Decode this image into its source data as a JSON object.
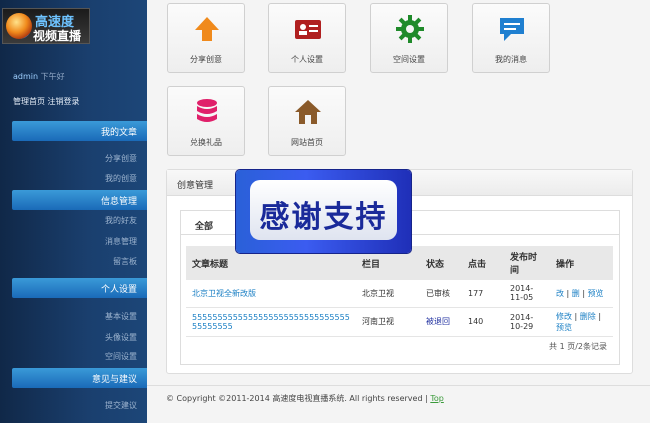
{
  "brand": {
    "line1": "高速度",
    "line2": "视频直播"
  },
  "user": {
    "name": "admin",
    "greeting": "下午好"
  },
  "top_links": "管理首页 注销登录",
  "sidebar": {
    "sections": [
      {
        "title": "我的文章",
        "items": [
          "分享创意",
          "我的创意"
        ]
      },
      {
        "title": "信息管理",
        "items": [
          "我的好友",
          "消息管理",
          "留言板"
        ]
      },
      {
        "title": "个人设置",
        "items": [
          "基本设置",
          "头像设置",
          "空间设置"
        ]
      },
      {
        "title": "意见与建议",
        "items": [
          "提交建议"
        ]
      }
    ]
  },
  "tiles": [
    {
      "label": "分享创意",
      "icon": "upload-arrow-icon",
      "color": "#f08a1c"
    },
    {
      "label": "个人设置",
      "icon": "id-card-icon",
      "color": "#b02020"
    },
    {
      "label": "空间设置",
      "icon": "gear-icon",
      "color": "#1f8a2a"
    },
    {
      "label": "我的消息",
      "icon": "chat-bubble-icon",
      "color": "#1f7fd0"
    },
    {
      "label": "兑换礼品",
      "icon": "database-icon",
      "color": "#e0206a"
    },
    {
      "label": "网站首页",
      "icon": "home-icon",
      "color": "#8a5a2a"
    }
  ],
  "panel": {
    "title": "创意管理",
    "tab": "全部",
    "columns": [
      "文章标题",
      "栏目",
      "状态",
      "点击",
      "发布时间",
      "操作"
    ],
    "rows": [
      {
        "title": "北京卫视全新改版",
        "column": "北京卫视",
        "status": "已审核",
        "clicks": "177",
        "date": "2014-11-05",
        "actions": [
          "改",
          "删",
          "预览"
        ]
      },
      {
        "title": "555555555555555555555555555555555555555",
        "column": "河南卫视",
        "status": "被退回",
        "clicks": "140",
        "date": "2014-10-29",
        "actions": [
          "修改",
          "删除",
          "预览"
        ]
      }
    ],
    "pagination": "共 1 页/2条记录"
  },
  "banner": {
    "text": "感谢支持"
  },
  "footer": {
    "text": "© Copyright ©2011-2014 高速度电视直播系统. All rights reserved |",
    "top": "Top"
  }
}
